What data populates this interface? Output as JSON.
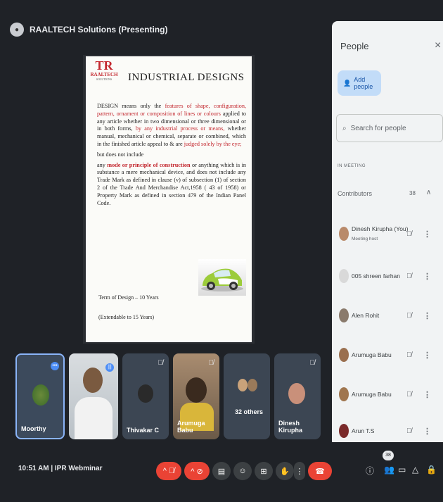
{
  "header": {
    "presenting_label": "RAALTECH Solutions (Presenting)"
  },
  "slide": {
    "logo_mark": "TR",
    "logo_name": "RAALTECH",
    "logo_sub": "SOLUTIONS",
    "title": "INDUSTRIAL DESIGNS",
    "p1_a": "DESIGN means only the ",
    "p1_b": "features of shape, configuration, pattern, ornament or composition of lines or colours",
    "p1_c": " applied to any article whether in two dimensional or three dimensional or in both forms, ",
    "p1_d": "by any industrial process or means,",
    "p1_e": " whether manual, mechanical or chemical, separate or combined, which in the finished article appeal to & are ",
    "p1_f": "judged solely by the eye;",
    "p2": "but does not include",
    "p3_a": "any ",
    "p3_b": "mode or principle of construction",
    "p3_c": " or anything which is in substance a mere mechanical device, and does not include any Trade Mark as defined in clause (v) of subsection (1) of section 2 of the Trade And Merchandise Act,1958 ( 43 of 1958) or Property Mark as defined in section 479 of the Indian Panel Code.",
    "term": "Term of Design – 10 Years",
    "extendable": "(Extendable to 15 Years)"
  },
  "people_panel": {
    "title": "People",
    "close_icon": "close-icon",
    "add_people": "Add people",
    "search_placeholder": "Search for people",
    "in_meeting": "IN MEETING",
    "contributors_label": "Contributors",
    "contributors_count": "38",
    "rows": [
      {
        "name": "Dinesh Kirupha (You)",
        "sub": "Meeting host",
        "color": "#b98a6a"
      },
      {
        "name": "005 shreen farhan",
        "sub": "",
        "color": "#d9d9d9"
      },
      {
        "name": "Alen Rohit",
        "sub": "",
        "color": "#8a7a6c"
      },
      {
        "name": "Arumuga Babu",
        "sub": "",
        "color": "#9a6f4f"
      },
      {
        "name": "Arumuga Babu",
        "sub": "",
        "color": "#a0764f"
      },
      {
        "name": "Arun T.S",
        "sub": "",
        "color": "#7a2a2a"
      }
    ]
  },
  "tiles": [
    {
      "label": "Moorthy"
    },
    {
      "label": ""
    },
    {
      "label": "Thivakar C"
    },
    {
      "label": "Arumuga Babu"
    },
    {
      "label": "32 others"
    },
    {
      "label": "Dinesh Kirupha"
    }
  ],
  "bottombar": {
    "time_meeting": "10:51 AM  |  IPR Webminar",
    "participants_badge": "38"
  },
  "colors": {
    "accent_blue": "#4c8df6",
    "end_call_red": "#ea4335"
  }
}
